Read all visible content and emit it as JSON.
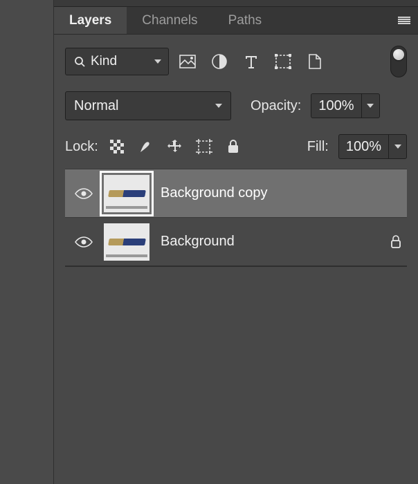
{
  "tabs": [
    {
      "label": "Layers",
      "active": true
    },
    {
      "label": "Channels",
      "active": false
    },
    {
      "label": "Paths",
      "active": false
    }
  ],
  "filter_kind": {
    "label": "Kind"
  },
  "blend_mode": {
    "label": "Normal"
  },
  "opacity": {
    "label": "Opacity:",
    "value": "100%"
  },
  "lock": {
    "label": "Lock:"
  },
  "fill": {
    "label": "Fill:",
    "value": "100%"
  },
  "layers": [
    {
      "name": "Background copy",
      "visible": true,
      "locked": false,
      "selected": true
    },
    {
      "name": "Background",
      "visible": true,
      "locked": true,
      "selected": false
    }
  ]
}
